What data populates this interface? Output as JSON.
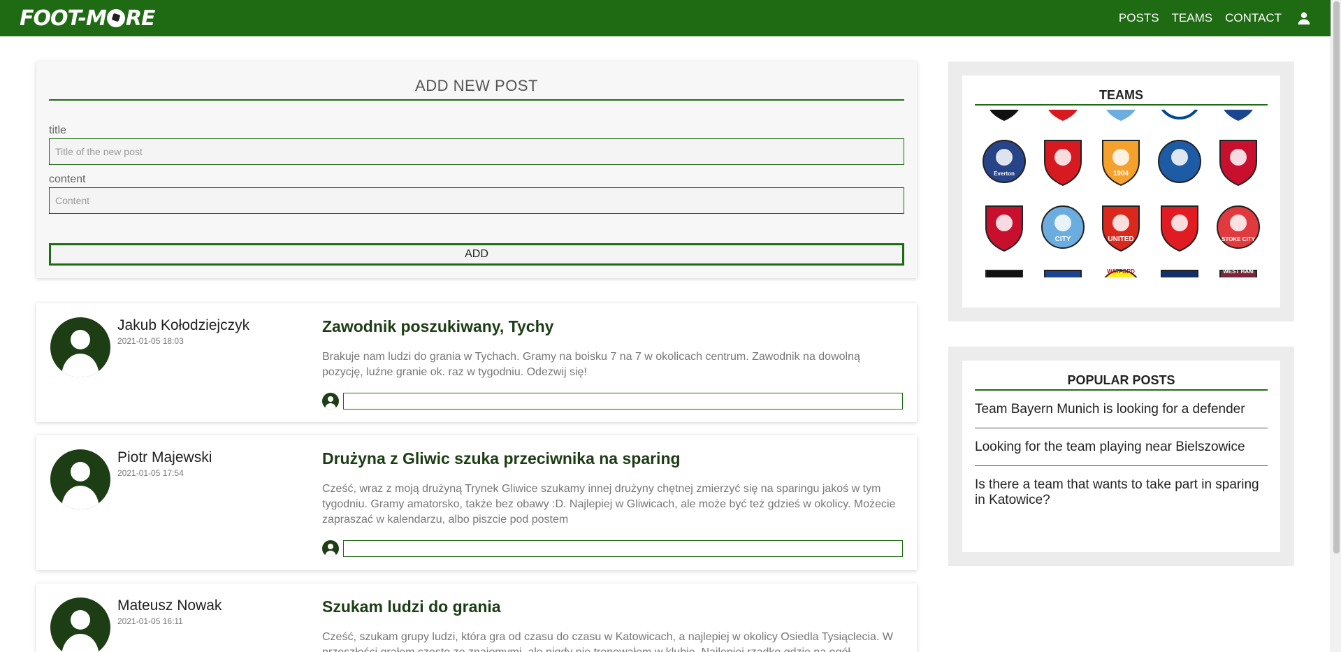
{
  "brand": {
    "logo_left": "FOOT-M",
    "logo_right": "RE",
    "color": "#1f6b13"
  },
  "nav": {
    "posts": "POSTS",
    "teams": "TEAMS",
    "contact": "CONTACT",
    "user_icon": "user-icon"
  },
  "add_post": {
    "heading": "ADD NEW POST",
    "title_label": "title",
    "title_placeholder": "Title of the new post",
    "content_label": "content",
    "content_placeholder": "Content",
    "button": "ADD"
  },
  "posts": [
    {
      "author": "Jakub Kołodziejczyk",
      "date": "2021-01-05 18:03",
      "title": "Zawodnik poszukiwany, Tychy",
      "content": "Brakuje nam ludzi do grania w Tychach. Gramy na boisku 7 na 7 w okolicach centrum. Zawodnik na dowolną pozycję, luźne granie ok. raz w tygodniu. Odezwij się!"
    },
    {
      "author": "Piotr Majewski",
      "date": "2021-01-05 17:54",
      "title": "Drużyna z Gliwic szuka przeciwnika na sparing",
      "content": "Cześć, wraz z moją drużyną Trynek Gliwice szukamy innej drużyny chętnej zmierzyć się na sparingu jakoś w tym tygodniu. Gramy amatorsko, także bez obawy :D. Najlepiej w Gliwicach, ale może być też gdzieś w okolicy. Możecie zapraszać w kalendarzu, albo piszcie pod postem"
    },
    {
      "author": "Mateusz Nowak",
      "date": "2021-01-05 16:11",
      "title": "Szukam ludzi do grania",
      "content": "Cześć, szukam grupy ludzi, która gra od czasu do czasu w Katowicach, a najlepiej w okolicy Osiedla Tysiąclecia. W przeszłości grałem często ze znajomymi, ale nigdy nie trenowałem w klubie. Najlepiej rzadko gdzie na ogół skrzydłach."
    }
  ],
  "sidebar": {
    "teams_title": "TEAMS",
    "popular_title": "POPULAR POSTS",
    "popular": [
      "Team Bayern Munich is looking for a defender",
      "Looking for the team playing near Bielszowice",
      "Is there a team that wants to take part in sparing in Katowice?"
    ],
    "crests": [
      {
        "icon": "crest-everton-icon",
        "text": "Everton",
        "color": "#274488"
      },
      {
        "icon": "crest-southampton-icon",
        "text": "",
        "color": "#d71920"
      },
      {
        "icon": "crest-hull-icon",
        "text": "1904",
        "color": "#f5a12d"
      },
      {
        "icon": "crest-leicester-icon",
        "text": "",
        "color": "#1d5ba4"
      },
      {
        "icon": "crest-liverpool-icon",
        "text": "",
        "color": "#c8102e"
      },
      {
        "icon": "crest-sunderland-icon",
        "text": "",
        "color": "#c8102e"
      },
      {
        "icon": "crest-mancity-icon",
        "text": "CITY",
        "color": "#6caddf"
      },
      {
        "icon": "crest-manutd-icon",
        "text": "UNITED",
        "color": "#da291c"
      },
      {
        "icon": "crest-middlesbrough-icon",
        "text": "",
        "color": "#e11b22"
      },
      {
        "icon": "crest-stoke-icon",
        "text": "STOKE CITY",
        "color": "#e03a3e"
      }
    ],
    "partial_crests": [
      "WATFORD",
      "WEST HAM"
    ]
  }
}
